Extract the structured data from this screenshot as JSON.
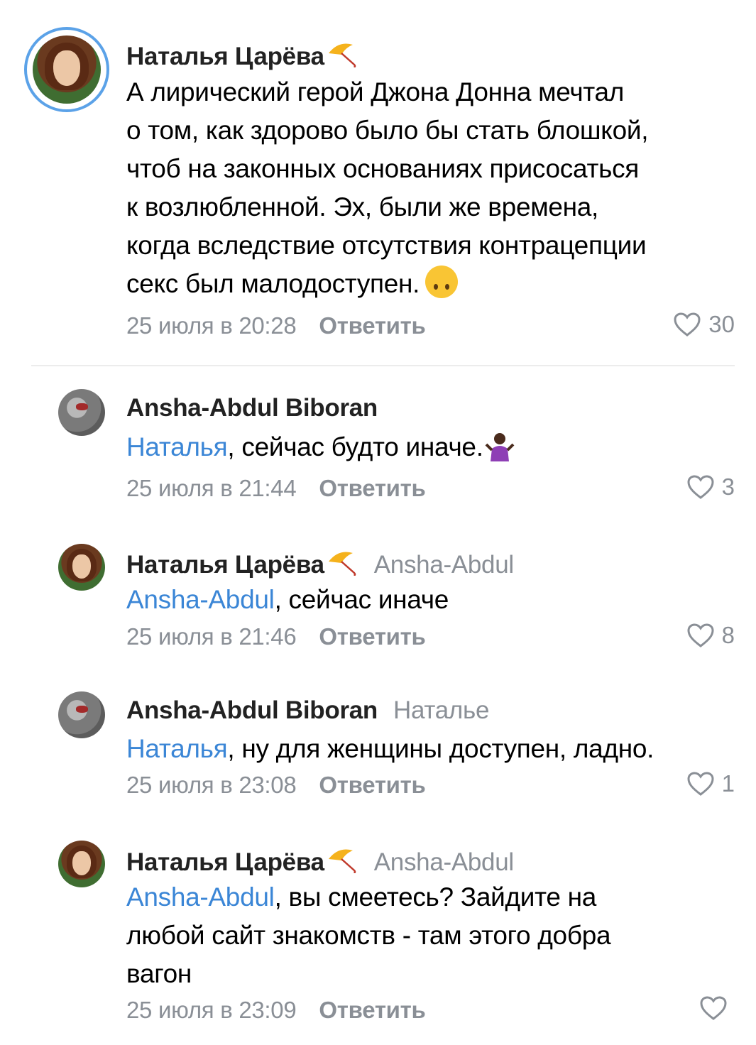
{
  "comments": [
    {
      "author": "Наталья Царёва",
      "reply_to": "",
      "mention": "",
      "text_lines": [
        "А лирический герой Джона Донна мечтал",
        "о том, как здорово было бы стать блошкой,",
        "чтоб на законных основаниях присосаться",
        "к возлюбленной. Эх, были же времена,",
        "когда вследствие отсутствия контрацепции",
        "секс был малодоступен."
      ],
      "emoji": "upside-down-face",
      "date": "25 июля в 20:28",
      "reply_label": "Ответить",
      "likes": "30"
    },
    {
      "author": "Ansha-Abdul Biboran",
      "reply_to": "",
      "mention": "Наталья",
      "text": ", сейчас будто иначе.",
      "emoji": "person-shrugging",
      "date": "25 июля в 21:44",
      "reply_label": "Ответить",
      "likes": "3"
    },
    {
      "author": "Наталья Царёва",
      "reply_to": "Ansha-Abdul",
      "mention": "Ansha-Abdul",
      "text": ", сейчас иначе",
      "date": "25 июля в 21:46",
      "reply_label": "Ответить",
      "likes": "8"
    },
    {
      "author": "Ansha-Abdul Biboran",
      "reply_to": "Наталье",
      "mention": "Наталья",
      "text": ", ну для женщины доступен, ладно.",
      "date": "25 июля в 23:08",
      "reply_label": "Ответить",
      "likes": "1"
    },
    {
      "author": "Наталья Царёва",
      "reply_to": "Ansha-Abdul",
      "mention": "Ansha-Abdul",
      "text_lines": [
        ", вы смеетесь? Зайдите на",
        "любой сайт знакомств - там этого добра",
        "вагон"
      ],
      "date": "25 июля в 23:09",
      "reply_label": "Ответить",
      "likes": ""
    }
  ],
  "colors": {
    "accent": "#3b86d6",
    "meta": "#8a8f96",
    "story_ring": "#5ba2e8"
  }
}
